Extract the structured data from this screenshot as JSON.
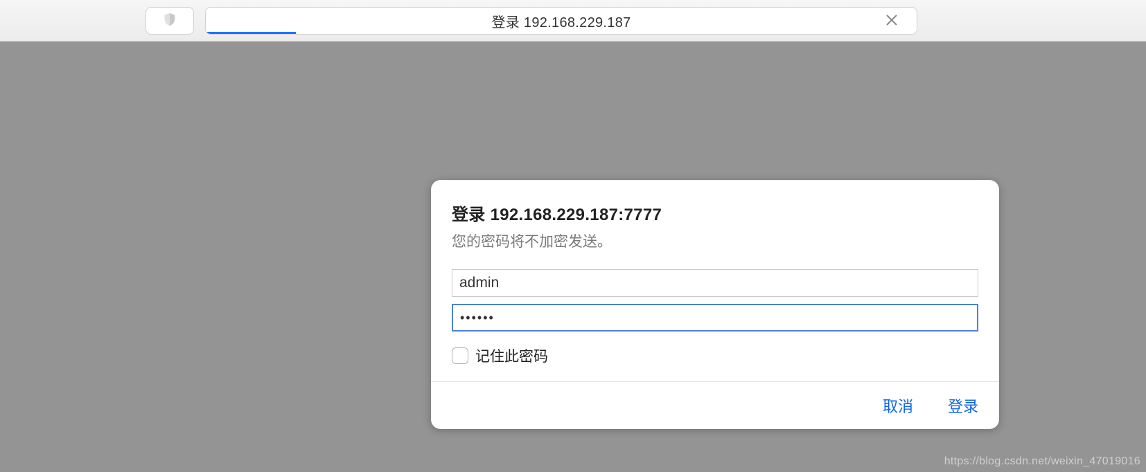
{
  "toolbar": {
    "address_text": "登录 192.168.229.187"
  },
  "dialog": {
    "title": "登录 192.168.229.187:7777",
    "subtitle": "您的密码将不加密发送。",
    "username_value": "admin",
    "password_value": "••••••",
    "remember_label": "记住此密码",
    "cancel_label": "取消",
    "login_label": "登录"
  },
  "watermark": "https://blog.csdn.net/weixin_47019016"
}
